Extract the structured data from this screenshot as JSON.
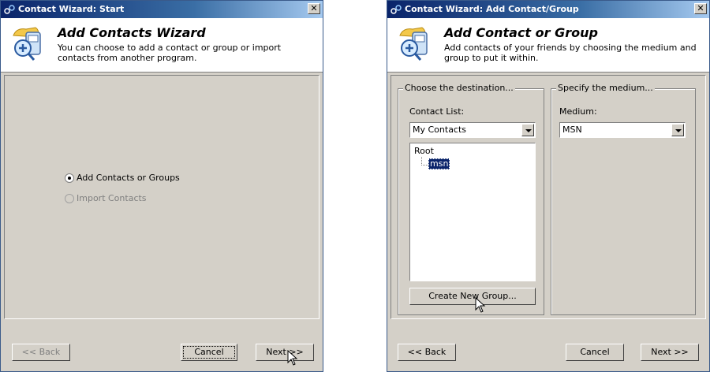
{
  "window1": {
    "title": "Contact Wizard: Start",
    "close_glyph": "✕",
    "header_title": "Add Contacts Wizard",
    "header_desc": "You can choose to add a contact or group or import contacts from another program.",
    "options": [
      {
        "label": "Add Contacts or Groups",
        "checked": true,
        "disabled": false
      },
      {
        "label": "Import Contacts",
        "checked": false,
        "disabled": true
      }
    ],
    "back_label": "<< Back",
    "cancel_label": "Cancel",
    "next_label": "Next >>"
  },
  "window2": {
    "title": "Contact Wizard: Add Contact/Group",
    "close_glyph": "✕",
    "header_title": "Add Contact or Group",
    "header_desc": "Add contacts of your friends by choosing the medium and group to put it within.",
    "destination_group": "Choose the destination...",
    "contact_list_label": "Contact List:",
    "contact_list_value": "My Contacts",
    "tree_root": "Root",
    "tree_selected": "msn",
    "create_group_label": "Create New Group...",
    "medium_group": "Specify the medium...",
    "medium_label": "Medium:",
    "medium_value": "MSN",
    "back_label": "<< Back",
    "cancel_label": "Cancel",
    "next_label": "Next >>"
  },
  "icons": {
    "title_icon": "contact-wizard-icon",
    "header_icon": "add-contact-icon",
    "cursor": "arrow-cursor"
  }
}
